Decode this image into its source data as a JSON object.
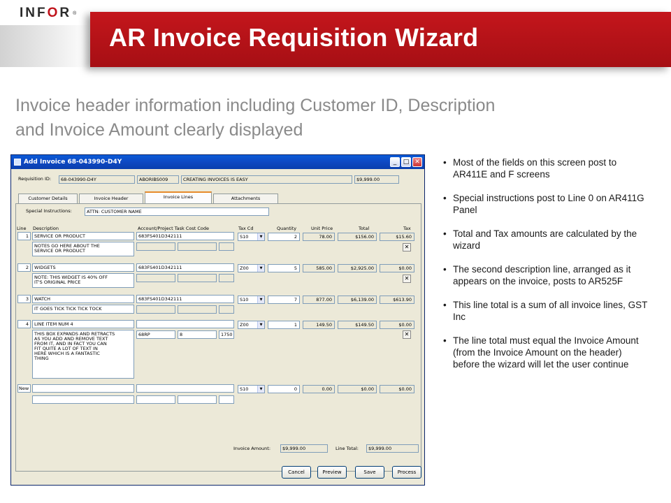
{
  "logo": {
    "text": "INF",
    "accent": "O",
    "tail": "R",
    "mark": "®"
  },
  "slide_title": "AR Invoice Requisition Wizard",
  "subtitle_line1": "Invoice header information including Customer ID, Description",
  "subtitle_line2": "and Invoice Amount clearly displayed",
  "bullets": [
    "Most of the fields on this screen post to AR411E and F screens",
    "Special instructions post to Line 0 on AR411G Panel",
    "Total and Tax amounts are calculated by the wizard",
    "The second description line, arranged as it appears on the invoice, posts to AR525F",
    "This line total is a sum of all invoice lines, GST Inc",
    "The line total must equal the Invoice Amount (from the Invoice Amount on the header) before the wizard will let the user continue"
  ],
  "window": {
    "title": "Add Invoice 68-043990-D4Y",
    "requisition_label": "Requisition ID:",
    "requisition_id": "68-043990-D4Y",
    "customer": "ABORIBS009",
    "description": "CREATING INVOICES IS EASY",
    "amount": "$9,999.00",
    "tabs": [
      "Customer Details",
      "Invoice Header",
      "Invoice Lines",
      "Attachments"
    ],
    "special_label": "Special Instructions:",
    "special_value": "ATTN: CUSTOMER NAME",
    "columns": {
      "line": "Line",
      "desc": "Description",
      "account": "Account/Project Task Cost Code",
      "tax_cd": "Tax Cd",
      "qty": "Quantity",
      "unit": "Unit Price",
      "total": "Total",
      "tax": "Tax"
    },
    "lines": [
      {
        "no": "1",
        "desc": "SERVICE OR PRODUCT",
        "desc2": "NOTES GO HERE ABOUT THE\nSERVICE OR PRODUCT",
        "account": "683FS401D342111",
        "acc2": "",
        "acc3": "",
        "tax_cd": "S10",
        "qty": "2",
        "unit": "78.00",
        "total": "$156.00",
        "tax": "$15.60"
      },
      {
        "no": "2",
        "desc": "WIDGETS",
        "desc2": "NOTE: THIS WIDGET IS 40% OFF\nIT'S ORIGINAL PRICE",
        "account": "683FS401D342111",
        "acc2": "",
        "acc3": "",
        "tax_cd": "Z00",
        "qty": "5",
        "unit": "585.00",
        "total": "$2,925.00",
        "tax": "$0.00"
      },
      {
        "no": "3",
        "desc": "WATCH",
        "desc2": "IT GOES TICK TICK TICK TOCK",
        "account": "683FS401D342111",
        "acc2": "",
        "acc3": "",
        "tax_cd": "S10",
        "qty": "7",
        "unit": "877.00",
        "total": "$6,139.00",
        "tax": "$613.90"
      },
      {
        "no": "4",
        "desc": "LINE ITEM NUM 4",
        "desc2": "THIS BOX EXPANDS AND RETRACTS\nAS YOU ADD AND REMOVE TEXT\nFROM IT, AND IN FACT YOU CAN\nFIT QUITE A LOT OF TEXT IN\nHERE WHICH IS A FANTASTIC\nTHING",
        "account": "68RP",
        "acc2": "8",
        "acc3": "1750",
        "tax_cd": "Z00",
        "qty": "1",
        "unit": "149.50",
        "total": "$149.50",
        "tax": "$0.00"
      }
    ],
    "new_row": {
      "no": "New",
      "tax_cd": "S10",
      "qty": "0",
      "unit": "0.00",
      "total": "$0.00",
      "tax": "$0.00"
    },
    "invoice_amount_label": "Invoice Amount:",
    "invoice_amount": "$9,999.00",
    "line_total_label": "Line Total:",
    "line_total": "$9,999.00",
    "buttons": [
      "Cancel",
      "Preview",
      "Save",
      "Process"
    ],
    "delete_glyph": "✕",
    "min_glyph": "_",
    "max_glyph": "□",
    "close_glyph": "✕",
    "dropdown_glyph": "▼"
  }
}
